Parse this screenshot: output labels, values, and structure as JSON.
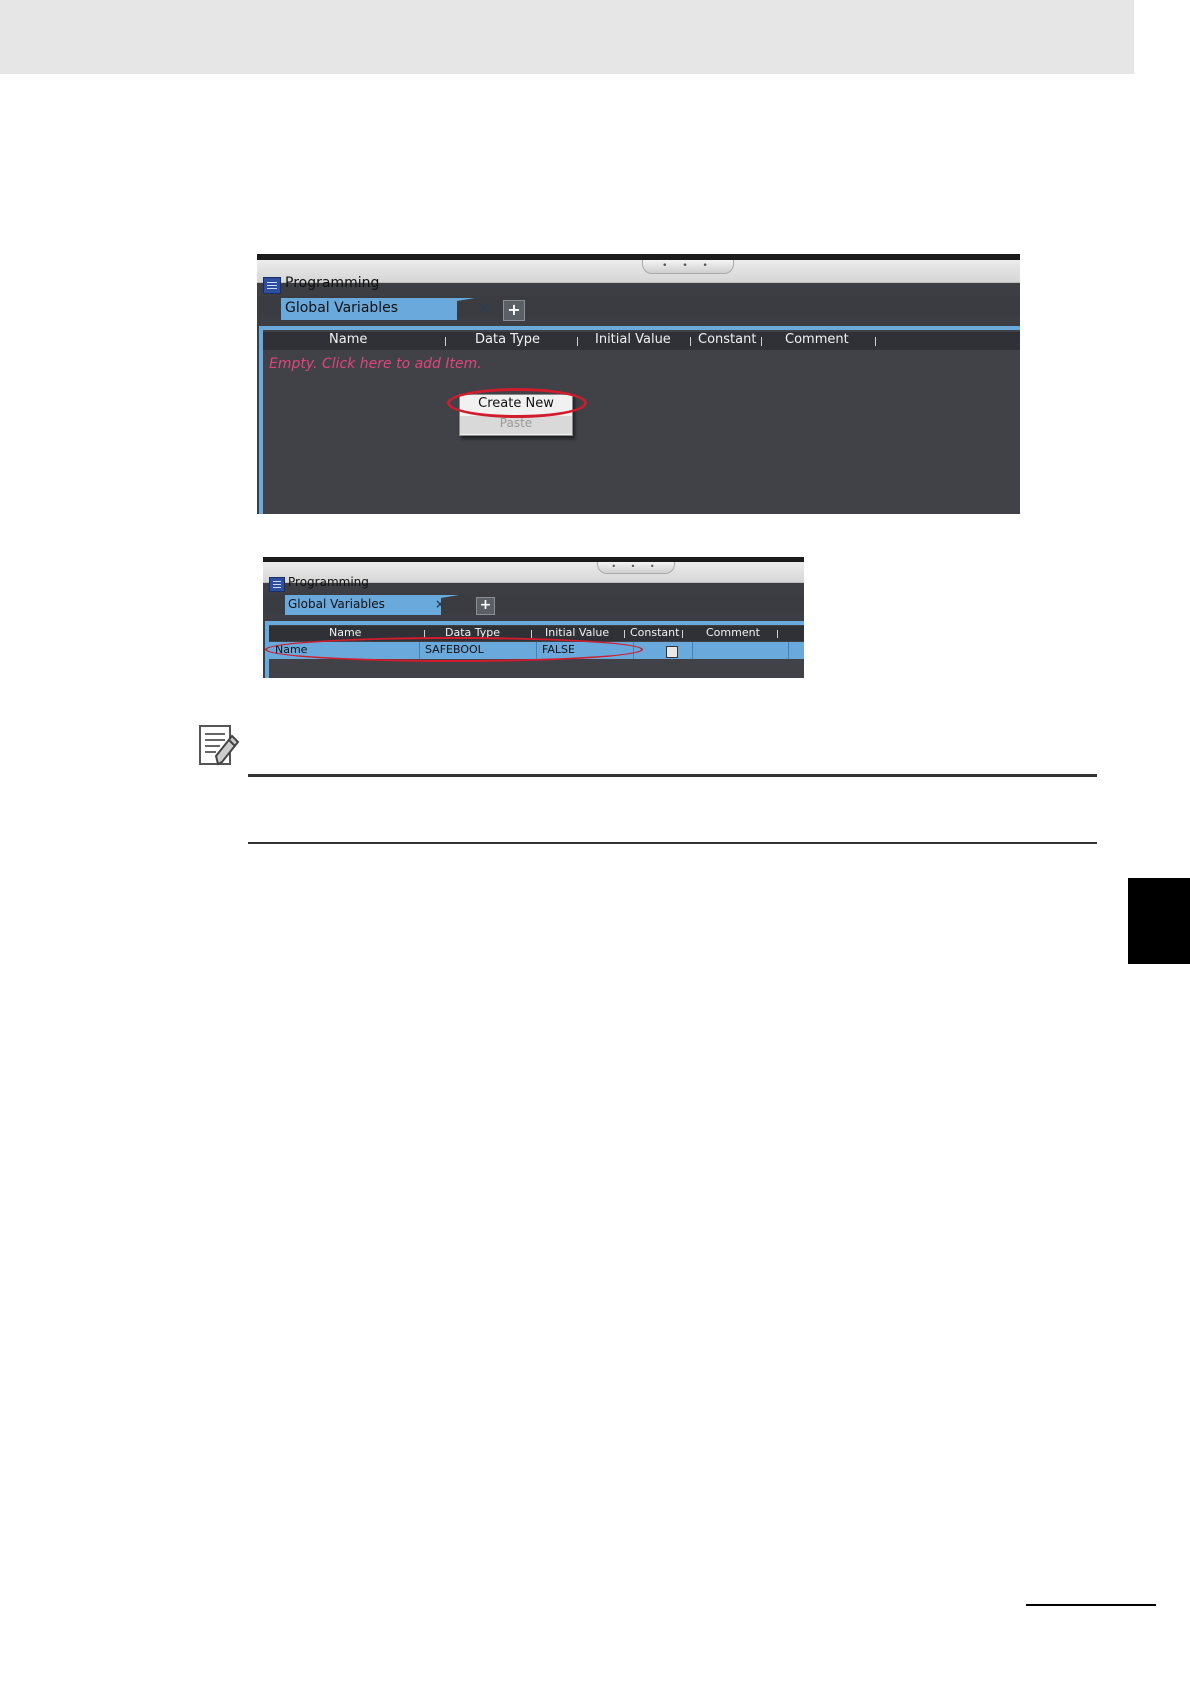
{
  "screenshot1": {
    "title": "Programming",
    "grip": "• • •",
    "tab_label": "Global Variables",
    "tab_close": "×",
    "add_tab": "+",
    "columns": [
      "Name",
      "Data Type",
      "Initial Value",
      "Constant",
      "Comment"
    ],
    "empty_text": "Empty. Click here to add Item.",
    "context_menu": [
      "Create New",
      "Paste"
    ]
  },
  "screenshot2": {
    "title": "Programming",
    "grip": "• • •",
    "tab_label": "Global Variables",
    "tab_close": "×",
    "add_tab": "+",
    "columns": [
      "Name",
      "Data Type",
      "Initial Value",
      "Constant",
      "Comment"
    ],
    "row": {
      "name": "Name",
      "data_type": "SAFEBOOL",
      "initial_value": "FALSE",
      "constant": false,
      "comment": ""
    }
  },
  "note": {
    "icon": "additional-information-icon"
  },
  "colors": {
    "accent": "#6aa9dc",
    "highlight_ring": "#d01c2c",
    "empty_text": "#e0457a"
  }
}
